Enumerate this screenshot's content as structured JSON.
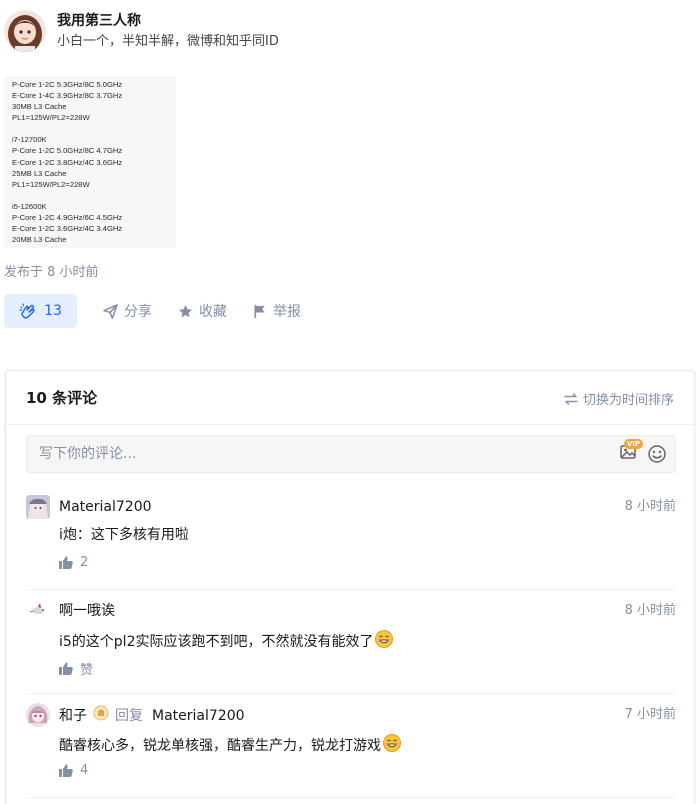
{
  "author": {
    "name": "我用第三人称",
    "bio": "小白一个，半知半解，微博和知乎同ID"
  },
  "spec_image": {
    "lines": [
      "P-Core 1-2C 5.3GHz/8C 5.0GHz",
      "E-Core 1-4C 3.9GHz/8C 3.7GHz",
      "30MB L3 Cache",
      "PL1=125W/PL2=228W",
      "",
      "i7-12700K",
      "P-Core 1-2C 5.0GHz/8C 4.7GHz",
      "E-Core 1-2C 3.8GHz/4C 3.6GHz",
      "25MB L3 Cache",
      "PL1=125W/PL2=228W",
      "",
      "i5-12600K",
      "P-Core 1-2C 4.9GHz/6C 4.5GHz",
      "E-Core 1-2C 3.6GHz/4C 3.4GHz",
      "20MB L3 Cache",
      "PL1=125W/PL2=228W"
    ]
  },
  "post": {
    "time": "发布于 8 小时前"
  },
  "actions": {
    "like_count": "13",
    "share": "分享",
    "collect": "收藏",
    "report": "举报"
  },
  "comments": {
    "count_label": "10 条评论",
    "sort_label": "切换为时间排序",
    "input_placeholder": "写下你的评论...",
    "vip_label": "VIP",
    "items": [
      {
        "user": "Material7200",
        "time": "8 小时前",
        "text": "i炮：这下多核有用啦",
        "likes": "2"
      },
      {
        "user": "啊一哦诶",
        "time": "8 小时前",
        "text": "i5的这个pl2实际应该跑不到吧，不然就没有能效了",
        "likes": "赞"
      },
      {
        "user": "和子",
        "reply_label": "回复",
        "reply_to": "Material7200",
        "time": "7 小时前",
        "text": "酷睿核心多，锐龙单核强，酷睿生产力，锐龙打游戏",
        "likes": "4"
      }
    ]
  },
  "colors": {
    "accent": "#1766ff",
    "muted": "#8590a6",
    "like_bg": "#e5eefe"
  }
}
